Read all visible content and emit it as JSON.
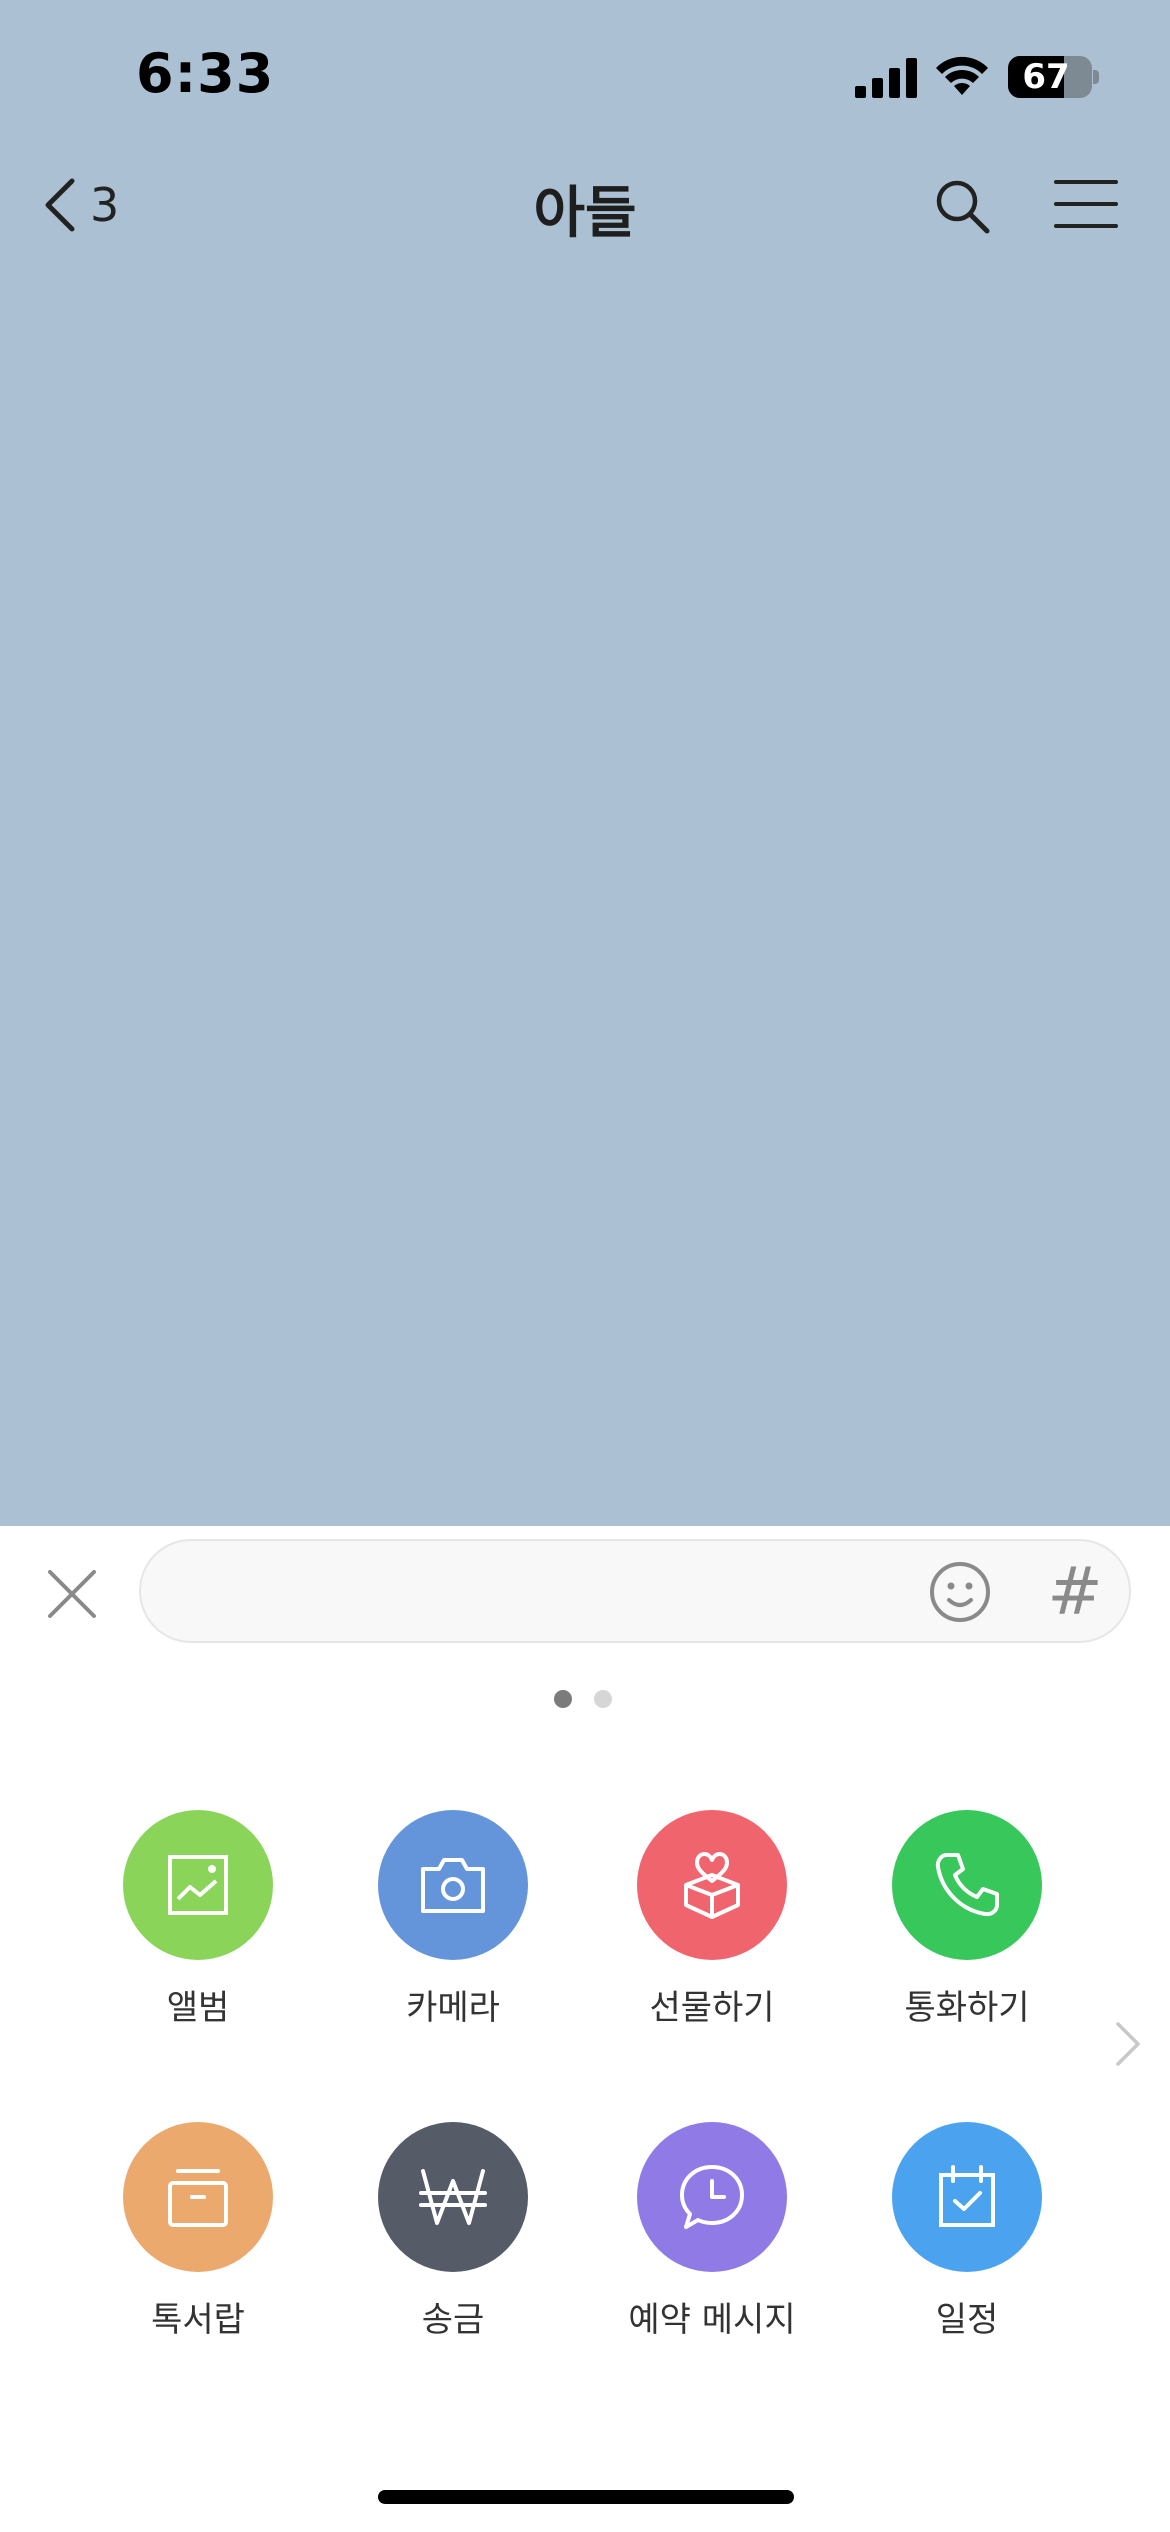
{
  "status_bar": {
    "time": "6:33",
    "battery": "67",
    "battery_level_percent": 67
  },
  "nav": {
    "back_count": "3",
    "title": "아들"
  },
  "input_bar": {
    "value": "",
    "placeholder": "",
    "hashtag": "#"
  },
  "pager": {
    "current": 1,
    "total": 2
  },
  "menu": {
    "items": [
      {
        "label": "앨범",
        "icon": "album-icon",
        "color": "#8bd45a"
      },
      {
        "label": "카메라",
        "icon": "camera-icon",
        "color": "#6495db"
      },
      {
        "label": "선물하기",
        "icon": "gift-icon",
        "color": "#f0646e"
      },
      {
        "label": "통화하기",
        "icon": "phone-icon",
        "color": "#37c75a"
      },
      {
        "label": "톡서랍",
        "icon": "drawer-icon",
        "color": "#eba96e"
      },
      {
        "label": "송금",
        "icon": "won-icon",
        "color": "#555c67"
      },
      {
        "label": "예약 메시지",
        "icon": "scheduled-message-icon",
        "color": "#8f7ae6"
      },
      {
        "label": "일정",
        "icon": "calendar-icon",
        "color": "#4ba3f0"
      }
    ]
  },
  "colors": {
    "chat_background": "#abc1d3",
    "panel_background": "#ffffff"
  }
}
